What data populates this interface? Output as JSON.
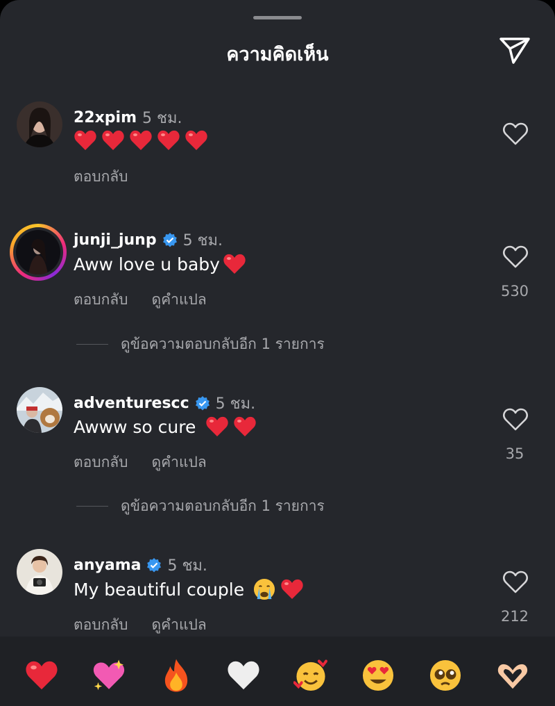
{
  "header": {
    "title": "ความคิดเห็น",
    "share_icon": "send-icon"
  },
  "comments": [
    {
      "username": "22xpim",
      "time": "5 ชม.",
      "verified": false,
      "text": "",
      "emojis": [
        "red-heart",
        "red-heart",
        "red-heart",
        "red-heart",
        "red-heart"
      ],
      "reply_label": "ตอบกลับ",
      "likes": ""
    },
    {
      "username": "junji_junp",
      "time": "5 ชม.",
      "verified": true,
      "text": "Aww love u baby",
      "emojis": [
        "red-heart"
      ],
      "reply_label": "ตอบกลับ",
      "translate_label": "ดูคำแปล",
      "likes": "530",
      "view_replies": "ดูข้อความตอบกลับอีก 1 รายการ"
    },
    {
      "username": "adventurescc",
      "time": "5 ชม.",
      "verified": true,
      "text": "Awww so cure",
      "emojis": [
        "red-heart",
        "red-heart"
      ],
      "reply_label": "ตอบกลับ",
      "translate_label": "ดูคำแปล",
      "likes": "35",
      "view_replies": "ดูข้อความตอบกลับอีก 1 รายการ"
    },
    {
      "username": "anyama",
      "time": "5 ชม.",
      "verified": true,
      "text": "My beautiful couple",
      "emojis": [
        "crying-face",
        "red-heart"
      ],
      "reply_label": "ตอบกลับ",
      "translate_label": "ดูคำแปล",
      "likes": "212"
    }
  ],
  "reaction_bar": [
    "red-heart",
    "sparkling-heart",
    "fire",
    "white-heart",
    "smiling-face-with-hearts",
    "heart-eyes",
    "pleading-face",
    "heart-hands"
  ],
  "colors": {
    "background": "#25272c",
    "accent_verified": "#3897f0",
    "heart_red": "#e8283a"
  }
}
